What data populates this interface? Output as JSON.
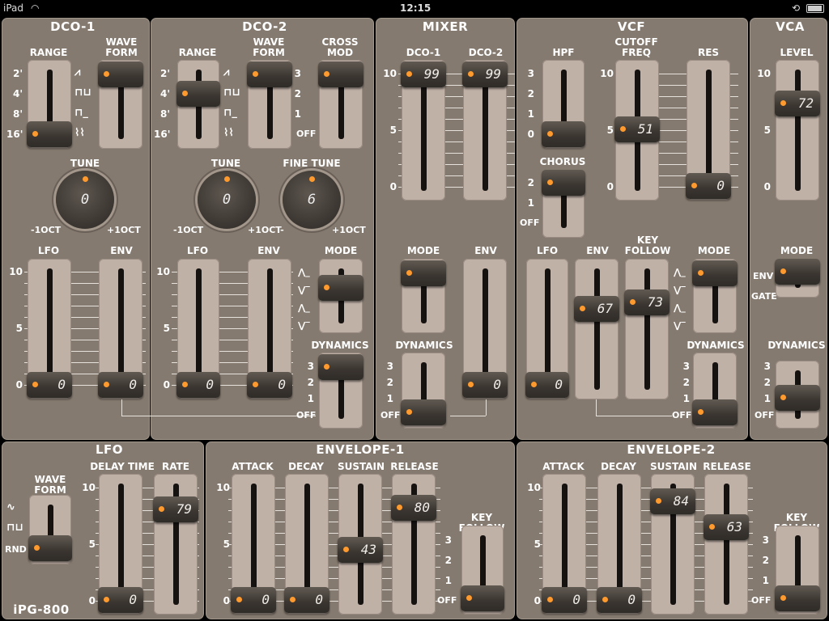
{
  "status": {
    "device": "iPad",
    "time": "12:15"
  },
  "brand": "iPG-800",
  "dco1": {
    "title": "DCO-1",
    "range": "RANGE",
    "wave": "WAVE\nFORM",
    "tune": "TUNE",
    "tune_val": "0",
    "oct_minus": "-1OCT",
    "oct_plus": "+1OCT",
    "lfo": "LFO",
    "env": "ENV",
    "lfo_val": "0",
    "env_val": "0"
  },
  "dco2": {
    "title": "DCO-2",
    "range": "RANGE",
    "wave": "WAVE\nFORM",
    "cross": "CROSS\nMOD",
    "tune": "TUNE",
    "tune_val": "0",
    "fine": "FINE TUNE",
    "fine_val": "6",
    "oct_minus": "-1OCT",
    "oct_plus_a": "+1OCT-",
    "oct_plus_b": "+1OCT",
    "lfo": "LFO",
    "env": "ENV",
    "lfo_val": "0",
    "env_val": "0",
    "mode": "MODE",
    "dyn": "DYNAMICS"
  },
  "mixer": {
    "title": "MIXER",
    "dco1": "DCO-1",
    "dco2": "DCO-2",
    "dco1_val": "99",
    "dco2_val": "99",
    "mode": "MODE",
    "env": "ENV",
    "dyn": "DYNAMICS",
    "env_val": "0"
  },
  "vcf": {
    "title": "VCF",
    "hpf": "HPF",
    "cutoff": "CUTOFF\nFREQ",
    "res": "RES",
    "cutoff_val": "51",
    "res_val": "0",
    "chorus": "CHORUS",
    "lfo": "LFO",
    "env": "ENV",
    "key": "KEY\nFOLLOW",
    "mode": "MODE",
    "dyn": "DYNAMICS",
    "lfo_val": "0",
    "env_val": "67",
    "key_val": "73"
  },
  "vca": {
    "title": "VCA",
    "level": "LEVEL",
    "level_val": "72",
    "mode": "MODE",
    "env": "ENV",
    "gate": "GATE",
    "dyn": "DYNAMICS"
  },
  "lfo": {
    "title": "LFO",
    "wave": "WAVE\nFORM",
    "delay": "DELAY TIME",
    "rate": "RATE",
    "rnd": "RND",
    "delay_val": "0",
    "rate_val": "79"
  },
  "env1": {
    "title": "ENVELOPE-1",
    "attack": "ATTACK",
    "decay": "DECAY",
    "sustain": "SUSTAIN",
    "release": "RELEASE",
    "key": "KEY\nFOLLOW",
    "a": "0",
    "d": "0",
    "s": "43",
    "r": "80"
  },
  "env2": {
    "title": "ENVELOPE-2",
    "attack": "ATTACK",
    "decay": "DECAY",
    "sustain": "SUSTAIN",
    "release": "RELEASE",
    "key": "KEY\nFOLLOW",
    "a": "0",
    "d": "0",
    "s": "84",
    "r": "63"
  },
  "ticks": {
    "t10": "10",
    "t5": "5",
    "t0": "0",
    "t3": "3",
    "t2": "2",
    "t1": "1",
    "off": "OFF",
    "r2": "2'",
    "r4": "4'",
    "r8": "8'",
    "r16": "16'"
  },
  "colors": {
    "panel": "#857a6f",
    "accent": "#ff9a2e",
    "fader": "#c0b1a7"
  }
}
